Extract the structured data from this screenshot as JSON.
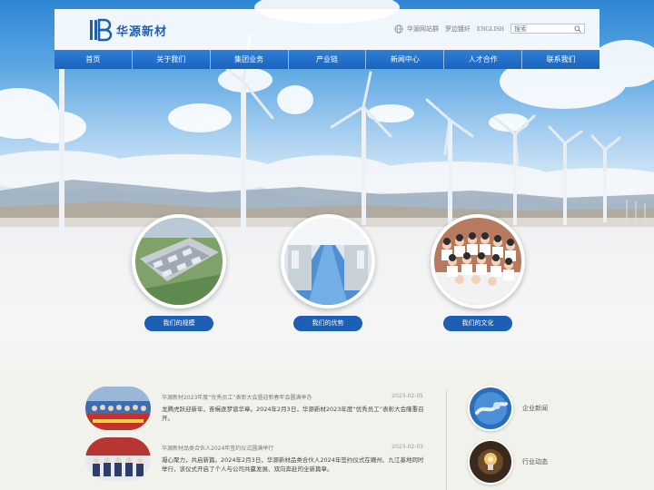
{
  "brand": {
    "name": "华源新材"
  },
  "top_links": [
    "华源网站群",
    "罗边镀纤",
    "ENGLISH"
  ],
  "search": {
    "placeholder": "搜索"
  },
  "nav": [
    "首页",
    "关于我们",
    "集团业务",
    "产业链",
    "新闻中心",
    "人才合作",
    "联系我们"
  ],
  "features": [
    {
      "label": "我们的规模"
    },
    {
      "label": "我们的优势"
    },
    {
      "label": "我们的文化"
    }
  ],
  "news": [
    {
      "title": "华源新材2023年度“优秀员工”表彰大会暨迎新春年会圆满举办",
      "date": "2023-02-05",
      "desc": "龙腾虎跃迎新年，奋楫逐梦谱华章。2024年2月3日，华源新材2023年度“优秀员工”表彰大会隆重召开。"
    },
    {
      "title": "华源新材品类合伙人2024年签约仪式圆满举行",
      "date": "2023-02-03",
      "desc": "凝心聚力，共启新篇。2024年2月3日，华源新材品类合伙人2024年签约仪式在赣州、九江基地同时举行，该仪式开启了个人与公司共赢发展、双向奔赴的全新篇章。"
    }
  ],
  "categories": [
    {
      "label": "企业新闻"
    },
    {
      "label": "行业动态"
    }
  ],
  "colors": {
    "nav": "#1a63bf",
    "button": "#1c5fb5",
    "brand": "#1f5fb0"
  }
}
